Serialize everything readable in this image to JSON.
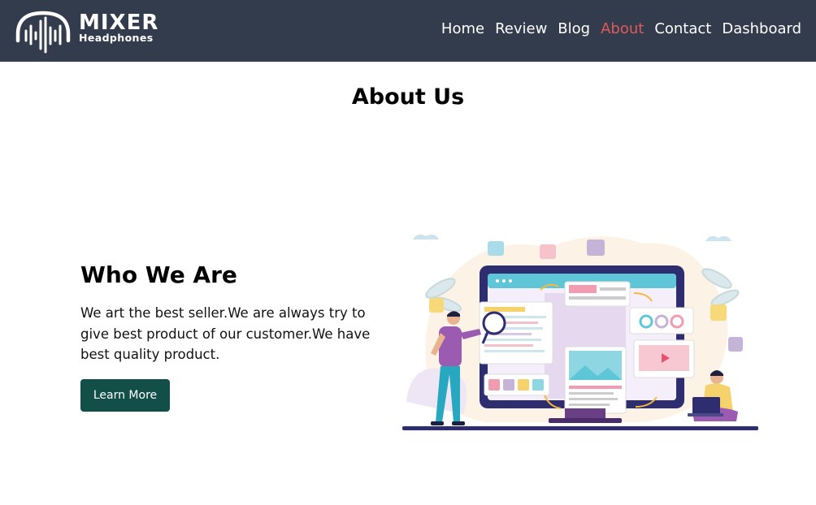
{
  "brand": {
    "title": "MIXER",
    "subtitle": "Headphones"
  },
  "nav": {
    "items": [
      {
        "label": "Home"
      },
      {
        "label": "Review"
      },
      {
        "label": "Blog"
      },
      {
        "label": "About"
      },
      {
        "label": "Contact"
      },
      {
        "label": "Dashboard"
      }
    ],
    "active": "About"
  },
  "page": {
    "title": "About Us"
  },
  "about": {
    "heading": "Who We Are",
    "text": "We art the best seller.We are always try to give best product of our customer.We have best quality product.",
    "button_label": "Learn More"
  },
  "colors": {
    "navbar_bg": "#333c4d",
    "active_link": "#e05a5a",
    "button_bg": "#134f49"
  },
  "icons": {
    "brand": "headphones-soundwave-icon"
  }
}
